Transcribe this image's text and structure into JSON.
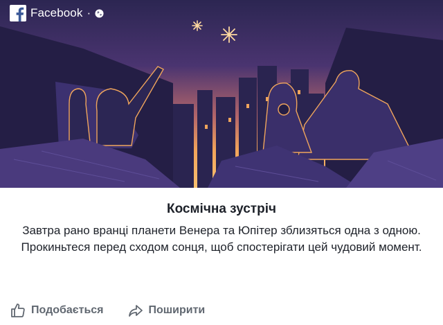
{
  "source": {
    "name": "Facebook",
    "separator": "·",
    "logo_icon": "facebook-logo-icon",
    "privacy_icon": "globe-icon"
  },
  "post": {
    "title": "Космічна зустріч",
    "description": "Завтра рано вранці планети Венера та Юпітер зблизяться одна з одною. Прокиньтеся перед сходом сонця, щоб спостерігати цей чудовий момент."
  },
  "actions": {
    "like_label": "Подобається",
    "share_label": "Поширити"
  },
  "colors": {
    "brand": "#3b5998",
    "sky_dark": "#2b2553",
    "sky_glow": "#f2a45a",
    "star": "#ffd9a0",
    "action_text": "#606770"
  }
}
